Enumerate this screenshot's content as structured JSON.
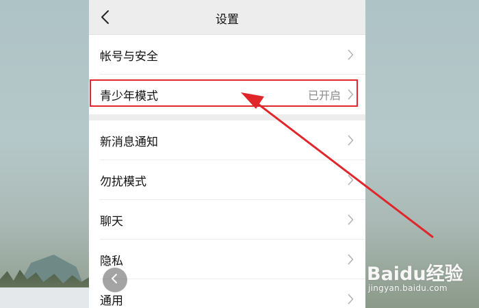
{
  "header": {
    "title": "设置",
    "back_icon": "chevron-left-icon"
  },
  "groups": [
    {
      "items": [
        {
          "label": "帐号与安全",
          "value": "",
          "icon": "chevron-right-icon"
        },
        {
          "label": "青少年模式",
          "value": "已开启",
          "icon": "chevron-right-icon",
          "highlighted": true
        }
      ]
    },
    {
      "items": [
        {
          "label": "新消息通知",
          "value": "",
          "icon": "chevron-right-icon"
        },
        {
          "label": "勿扰模式",
          "value": "",
          "icon": "chevron-right-icon"
        },
        {
          "label": "聊天",
          "value": "",
          "icon": "chevron-right-icon"
        },
        {
          "label": "隐私",
          "value": "",
          "icon": "chevron-right-icon"
        },
        {
          "label": "通用",
          "value": "",
          "icon": "chevron-right-icon"
        }
      ]
    }
  ],
  "annotation": {
    "highlight_color": "#e0262a",
    "arrow_color": "#e0262a"
  },
  "floating_button": {
    "icon": "chevron-left-icon"
  },
  "watermark": {
    "logo_text": "Baidu经验",
    "url": "jingyan.baidu.com"
  },
  "colors": {
    "page_bg": "#ededed",
    "cell_bg": "#ffffff",
    "text": "#111111",
    "secondary_text": "#8a8a8a"
  }
}
